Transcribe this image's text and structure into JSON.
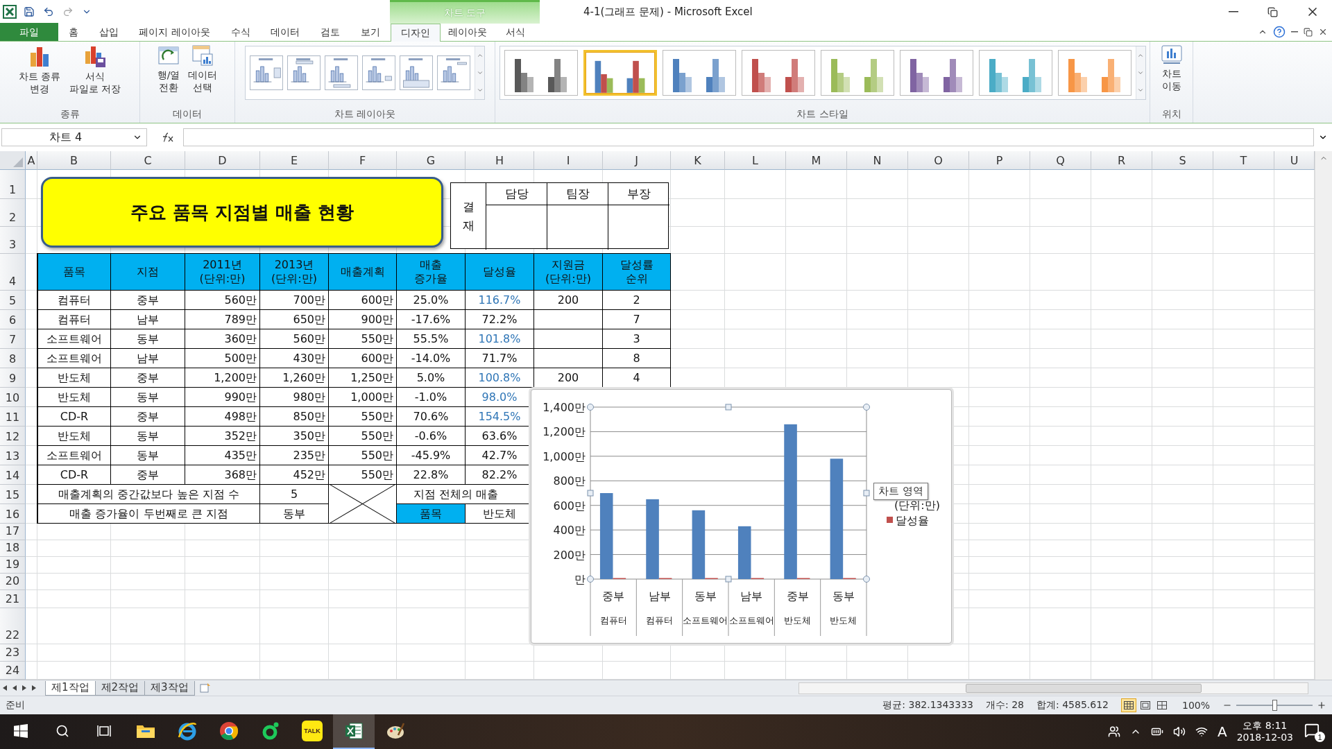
{
  "title_bar": {
    "title": "4-1(그래프 문제) - Microsoft Excel",
    "context_group": "차트 도구"
  },
  "ribbon_tabs": [
    {
      "label": "파일",
      "kind": "file",
      "selected": false
    },
    {
      "label": "홈",
      "kind": "normal",
      "selected": false
    },
    {
      "label": "삽입",
      "kind": "normal",
      "selected": false
    },
    {
      "label": "페이지 레이아웃",
      "kind": "normal",
      "selected": false
    },
    {
      "label": "수식",
      "kind": "normal",
      "selected": false
    },
    {
      "label": "데이터",
      "kind": "normal",
      "selected": false
    },
    {
      "label": "검토",
      "kind": "normal",
      "selected": false
    },
    {
      "label": "보기",
      "kind": "normal",
      "selected": false
    },
    {
      "label": "디자인",
      "kind": "context",
      "selected": true
    },
    {
      "label": "레이아웃",
      "kind": "context",
      "selected": false
    },
    {
      "label": "서식",
      "kind": "context",
      "selected": false
    }
  ],
  "ribbon_groups": [
    {
      "label": "종류",
      "kind": "buttons",
      "buttons": [
        {
          "label": "차트 종류\n변경",
          "kind": "chart-type"
        },
        {
          "label": "서식\n파일로 저장",
          "kind": "template"
        }
      ]
    },
    {
      "label": "데이터",
      "kind": "buttons",
      "buttons": [
        {
          "label": "행/열\n전환",
          "kind": "switch"
        },
        {
          "label": "데이터\n선택",
          "kind": "select-data"
        }
      ]
    },
    {
      "label": "차트 레이아웃",
      "kind": "layouts",
      "items": [
        {
          "kind": "legend-right"
        },
        {
          "kind": "legend-top"
        },
        {
          "kind": "legend-bottom"
        },
        {
          "kind": "axis-titles"
        },
        {
          "kind": "data-table"
        },
        {
          "kind": "title-legend"
        }
      ]
    },
    {
      "label": "차트 스타일",
      "kind": "styles",
      "items": [
        {
          "kind": "mono",
          "color": "#595959",
          "selected": false
        },
        {
          "kind": "multi",
          "color": "#4f81bd",
          "selected": true
        },
        {
          "kind": "mono",
          "color": "#4f81bd",
          "selected": false
        },
        {
          "kind": "mono",
          "color": "#c0504d",
          "selected": false
        },
        {
          "kind": "mono",
          "color": "#9bbb59",
          "selected": false
        },
        {
          "kind": "mono",
          "color": "#8064a2",
          "selected": false
        },
        {
          "kind": "mono",
          "color": "#4bacc6",
          "selected": false
        },
        {
          "kind": "mono",
          "color": "#f79646",
          "selected": false
        }
      ]
    },
    {
      "label": "위치",
      "kind": "buttons",
      "buttons": [
        {
          "label": "차트\n이동",
          "kind": "move-chart"
        }
      ]
    }
  ],
  "name_box": "차트 4",
  "sheet": {
    "columns": [
      "A",
      "B",
      "C",
      "D",
      "E",
      "F",
      "G",
      "H",
      "I",
      "J",
      "K",
      "L",
      "M",
      "N",
      "O",
      "P",
      "Q",
      "R",
      "S",
      "T",
      "U"
    ],
    "row_numbers": [
      "1",
      "2",
      "3",
      "4",
      "5",
      "6",
      "7",
      "8",
      "9",
      "10",
      "11",
      "12",
      "13",
      "14",
      "15",
      "16",
      "17",
      "18",
      "19",
      "20",
      "21",
      "22",
      "23",
      "24"
    ]
  },
  "title_shape": {
    "text": "주요 품목 지점별 매출 현황"
  },
  "approval": {
    "side_label": "결재",
    "headers": [
      "담당",
      "팀장",
      "부장"
    ]
  },
  "table": {
    "header": [
      "품목",
      "지점",
      "2011년\n(단위:만)",
      "2013년\n(단위:만)",
      "매출계획",
      "매출\n증가율",
      "달성율",
      "지원금\n(단위:만)",
      "달성률\n순위"
    ],
    "rows": [
      {
        "cells": [
          "컴퓨터",
          "중부",
          "560만",
          "700만",
          "600만",
          "25.0%",
          "116.7%",
          "200",
          "2"
        ],
        "highlight": true
      },
      {
        "cells": [
          "컴퓨터",
          "남부",
          "789만",
          "650만",
          "900만",
          "-17.6%",
          "72.2%",
          null,
          "7"
        ],
        "highlight": false
      },
      {
        "cells": [
          "소프트웨어",
          "동부",
          "360만",
          "560만",
          "550만",
          "55.5%",
          "101.8%",
          null,
          "3"
        ],
        "highlight": true
      },
      {
        "cells": [
          "소프트웨어",
          "남부",
          "500만",
          "430만",
          "600만",
          "-14.0%",
          "71.7%",
          null,
          "8"
        ],
        "highlight": false
      },
      {
        "cells": [
          "반도체",
          "중부",
          "1,200만",
          "1,260만",
          "1,250만",
          "5.0%",
          "100.8%",
          "200",
          "4"
        ],
        "highlight": true
      },
      {
        "cells": [
          "반도체",
          "동부",
          "990만",
          "980만",
          "1,000만",
          "-1.0%",
          "98.0%"
        ],
        "highlight": true
      },
      {
        "cells": [
          "CD-R",
          "중부",
          "498만",
          "850만",
          "550만",
          "70.6%",
          "154.5%"
        ],
        "highlight": true
      },
      {
        "cells": [
          "반도체",
          "동부",
          "352만",
          "350만",
          "550만",
          "-0.6%",
          "63.6%"
        ],
        "highlight": false
      },
      {
        "cells": [
          "소프트웨어",
          "동부",
          "435만",
          "235만",
          "550만",
          "-45.9%",
          "42.7%"
        ],
        "highlight": false
      },
      {
        "cells": [
          "CD-R",
          "중부",
          "368만",
          "452만",
          "550만",
          "22.8%",
          "82.2%"
        ],
        "highlight": false
      }
    ]
  },
  "summary": [
    {
      "label": "매출계획의 중간값보다 높은 지점 수",
      "value": "5"
    },
    {
      "label": "매출 증가율이 두번째로 큰 지점",
      "value": "동부"
    }
  ],
  "summary_note": "지점 전체의 매출",
  "lookup": {
    "label": "품목",
    "value": "반도체"
  },
  "chart": {
    "tooltip": "차트 영역",
    "outer_labels": [
      "컴퓨터",
      "컴퓨터",
      "소프트웨어",
      "소프트웨어",
      "반도체",
      "반도체"
    ],
    "legend": [
      {
        "marker": false
      },
      {
        "marker": true
      }
    ],
    "chart_data": {
      "type": "bar",
      "grid": true,
      "categories": [
        "중부",
        "남부",
        "동부",
        "남부",
        "중부",
        "동부"
      ],
      "series": [
        {
          "name": "(단위:만)",
          "color": "#4f81bd",
          "values": [
            700,
            650,
            560,
            430,
            1260,
            980
          ]
        },
        {
          "name": "달성율",
          "color": "#c0504d",
          "values": [
            1.2,
            0.7,
            1.0,
            0.7,
            1.0,
            1.0
          ]
        }
      ],
      "ylim": [
        0,
        1400
      ],
      "yticks": [
        {
          "value": 0,
          "label": "만"
        },
        {
          "value": 200,
          "label": "200만"
        },
        {
          "value": 400,
          "label": "400만"
        },
        {
          "value": 600,
          "label": "600만"
        },
        {
          "value": 800,
          "label": "800만"
        },
        {
          "value": 1000,
          "label": "1,000만"
        },
        {
          "value": 1200,
          "label": "1,200만"
        },
        {
          "value": 1400,
          "label": "1,400만"
        }
      ]
    }
  },
  "sheet_tabs": [
    {
      "label": "제1작업",
      "selected": true
    },
    {
      "label": "제2작업",
      "selected": false
    },
    {
      "label": "제3작업",
      "selected": false
    }
  ],
  "status_bar": {
    "ready": "준비",
    "average": "평균: 382.1343333",
    "count": "개수: 28",
    "sum": "합계: 4585.612",
    "zoom": "100%",
    "views": [
      {
        "kind": "normal",
        "selected": true
      },
      {
        "kind": "layout",
        "selected": false
      },
      {
        "kind": "break",
        "selected": false
      }
    ],
    "zoom_slider": {
      "level": 0.5
    }
  },
  "taskbar": {
    "apps": [
      {
        "kind": "explorer",
        "selected": false
      },
      {
        "kind": "ie",
        "selected": false
      },
      {
        "kind": "chrome",
        "selected": false
      },
      {
        "kind": "ring",
        "selected": false
      },
      {
        "kind": "kakao",
        "text": "TALK",
        "selected": false
      },
      {
        "kind": "excel",
        "selected": true
      },
      {
        "kind": "paint",
        "selected": false
      }
    ],
    "ime": "A",
    "time": "오후 8:11",
    "date": "2018-12-03",
    "notifications": "1"
  }
}
